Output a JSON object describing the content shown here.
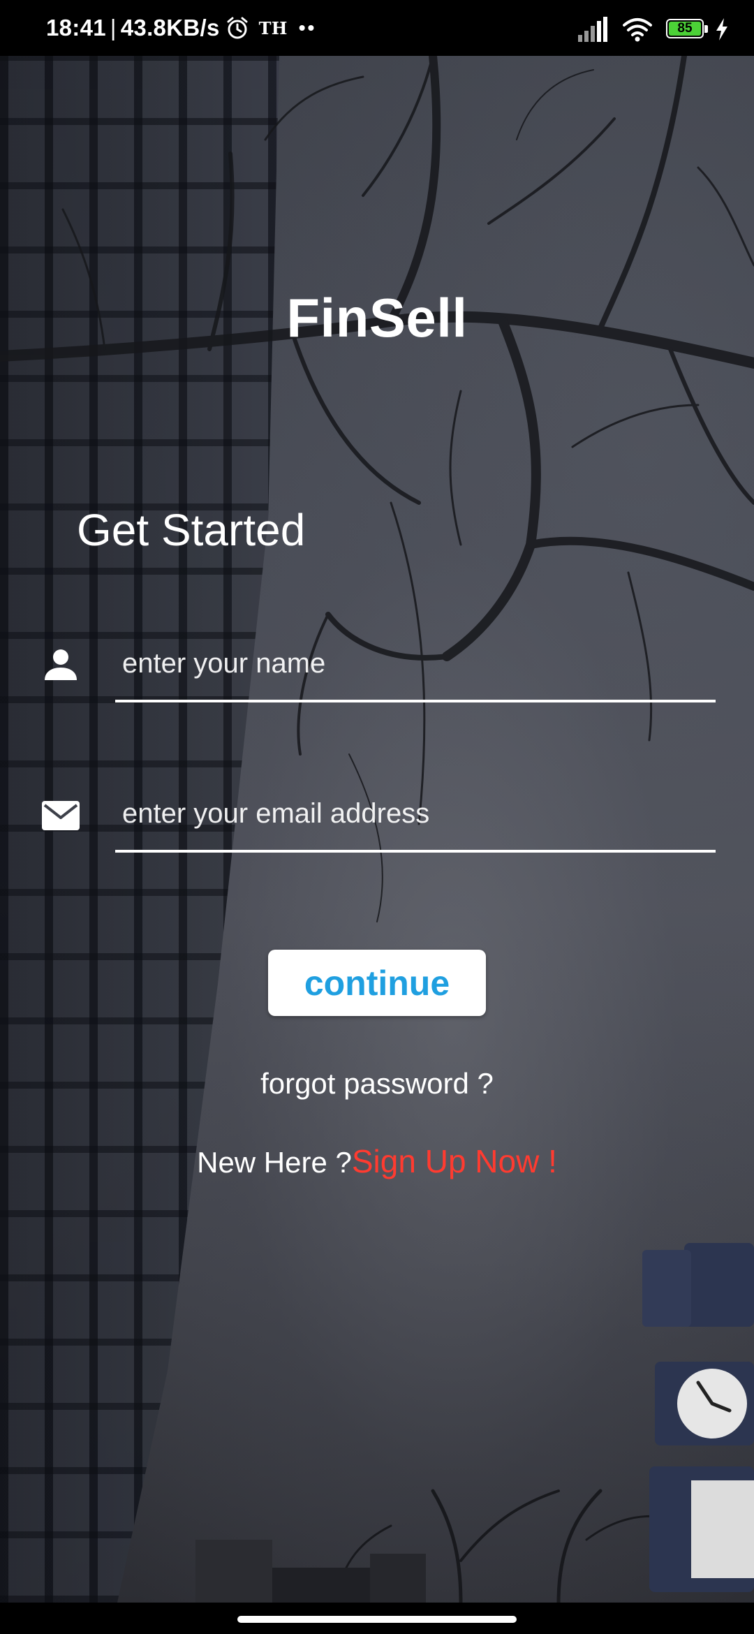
{
  "status_bar": {
    "time": "18:41",
    "network_speed": "43.8KB/s",
    "carrier_badge": "TH",
    "more_dots": "••",
    "battery_level": "85",
    "icons": [
      "alarm-icon",
      "signal-icon",
      "wifi-icon",
      "battery-icon",
      "charging-icon"
    ]
  },
  "app": {
    "title": "FinSell"
  },
  "form": {
    "heading": "Get Started",
    "name_placeholder": "enter your name",
    "name_value": "",
    "email_placeholder": "enter your email address",
    "email_value": "",
    "name_icon": "person-icon",
    "email_icon": "mail-icon",
    "continue_label": "continue",
    "forgot_label": "forgot password ?",
    "new_here_label": "New Here ?",
    "signup_label": "Sign Up Now !"
  },
  "colors": {
    "accent_blue": "#1f9fe0",
    "signup_red": "#ff3b30",
    "battery_green": "#4cd137"
  }
}
